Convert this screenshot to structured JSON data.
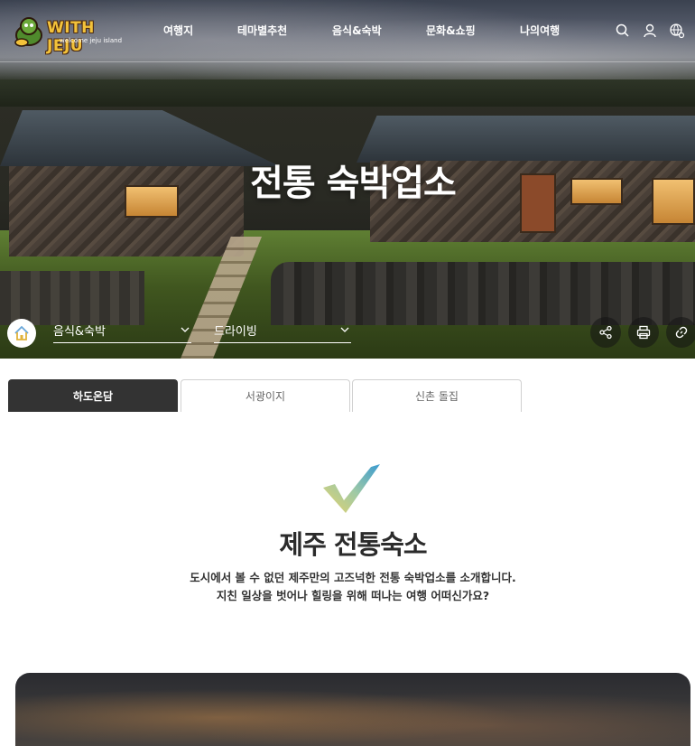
{
  "brand": {
    "name": "WITH JEJU",
    "tagline": "welcome jeju island"
  },
  "nav": {
    "items": [
      "여행지",
      "테마별추천",
      "음식&숙박",
      "문화&쇼핑",
      "나의여행"
    ]
  },
  "header_icons": [
    "search-icon",
    "user-icon",
    "language-icon"
  ],
  "hero": {
    "title": "전통 숙박업소"
  },
  "breadcrumb": {
    "home_icon": "home-icon",
    "level1": "음식&숙박",
    "level2": "드라이빙"
  },
  "actions": [
    "share-icon",
    "print-icon",
    "link-icon"
  ],
  "tabs": [
    {
      "label": "하도온담",
      "active": true
    },
    {
      "label": "서광이지",
      "active": false
    },
    {
      "label": "신촌 돌집",
      "active": false
    }
  ],
  "intro": {
    "title": "제주 전통숙소",
    "line1": "도시에서 볼 수 없던 제주만의 고즈넉한 전통 숙박업소를 소개합니다.",
    "line2": "지친 일상을 벗어나 힐링을 위해 떠나는 여행 어떠신가요?"
  },
  "colors": {
    "active_tab": "#333333",
    "accent_yellow": "#f3c23a"
  }
}
